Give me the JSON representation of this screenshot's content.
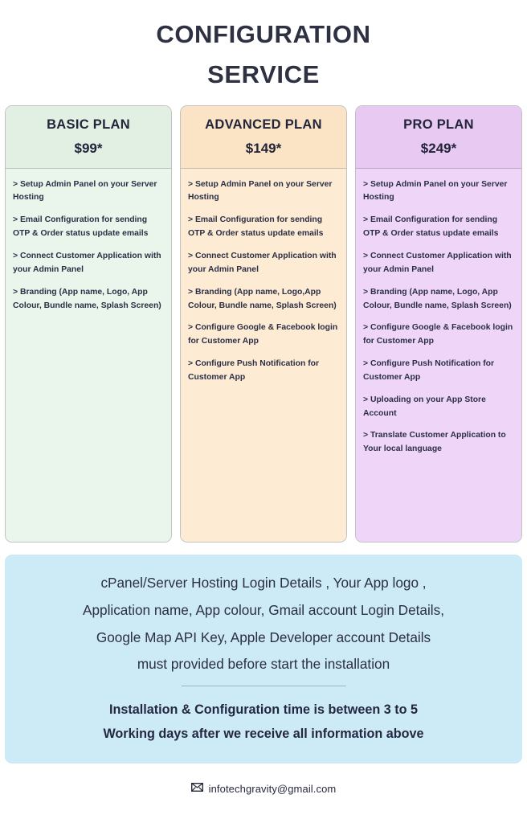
{
  "title": {
    "line1": "CONFIGURATION",
    "line2": "SERVICE"
  },
  "plans": [
    {
      "name": "BASIC PLAN",
      "price": "$99*",
      "header_color": "#e2f0e4",
      "body_color": "#eaf6ec",
      "features": [
        "> Setup Admin Panel on your Server Hosting",
        "> Email Configuration for sending OTP & Order status update emails",
        "> Connect Customer Application with your Admin Panel",
        "> Branding (App name, Logo, App Colour, Bundle name, Splash Screen)"
      ]
    },
    {
      "name": "ADVANCED PLAN",
      "price": "$149*",
      "header_color": "#fbe4c6",
      "body_color": "#fdebd4",
      "features": [
        "> Setup Admin Panel on your Server Hosting",
        "> Email Configuration for sending OTP & Order status update emails",
        "> Connect Customer Application with your Admin Panel",
        "> Branding (App name, Logo,App Colour, Bundle name, Splash Screen)",
        "> Configure Google & Facebook login  for Customer App",
        "> Configure Push Notification for Customer App"
      ]
    },
    {
      "name": "PRO PLAN",
      "price": "$249*",
      "header_color": "#e8c9f2",
      "body_color": "#efd6f8",
      "features": [
        "> Setup Admin Panel on your Server Hosting",
        "> Email Configuration for sending OTP & Order status update emails",
        "> Connect Customer Application with your Admin Panel",
        "> Branding (App name, Logo, App Colour, Bundle name, Splash Screen)",
        "> Configure Google & Facebook login  for Customer App",
        "> Configure Push Notification for Customer App",
        "> Uploading on your App Store Account",
        "> Translate Customer Application  to Your local language"
      ]
    }
  ],
  "notice": {
    "background_color": "#cdeaf7",
    "lines": [
      "cPanel/Server Hosting Login Details , Your App logo ,",
      "Application name, App colour, Gmail account Login Details,",
      "Google Map API Key, Apple Developer account Details",
      "must provided before start the installation"
    ],
    "strong_lines": [
      "Installation & Configuration time is between 3 to 5",
      "Working days after we receive all information above"
    ]
  },
  "footer": {
    "email": "infotechgravity@gmail.com",
    "icon": "envelope-icon"
  }
}
